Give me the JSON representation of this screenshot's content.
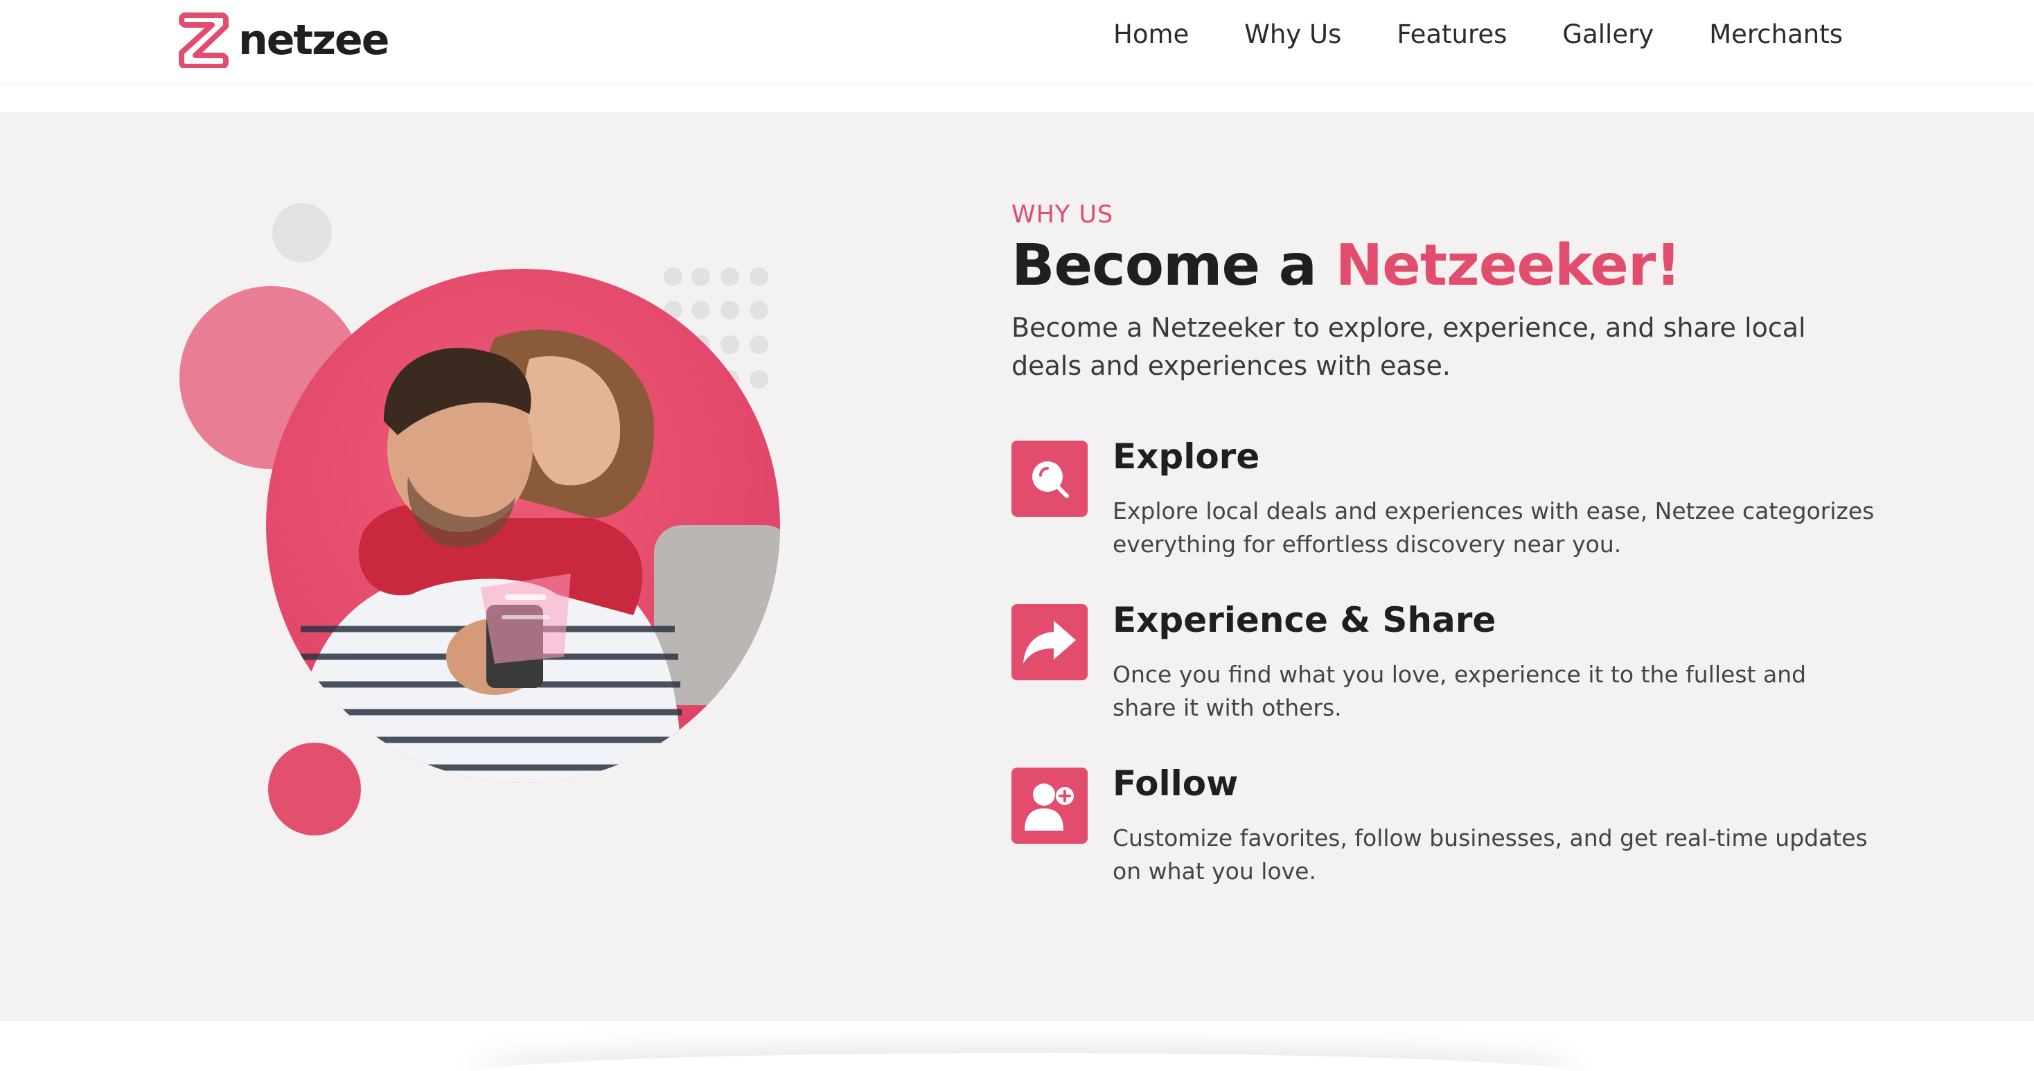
{
  "brand": {
    "name": "netzee",
    "accent": "#e34d6d"
  },
  "nav": {
    "items": [
      "Home",
      "Why Us",
      "Features",
      "Gallery",
      "Merchants"
    ]
  },
  "hero": {
    "eyebrow": "WHY US",
    "headline_prefix": "Become a ",
    "headline_accent": "Netzeeker!",
    "intro": "Become a Netzeeker to explore, experience, and share local deals and experiences with ease."
  },
  "features": [
    {
      "icon": "search-icon",
      "title": "Explore",
      "description": "Explore local deals and experiences with ease, Netzee categorizes everything for effortless discovery near you."
    },
    {
      "icon": "share-arrow-icon",
      "title": "Experience & Share",
      "description": "Once you find what you love, experience it to the fullest and share it with others."
    },
    {
      "icon": "user-plus-icon",
      "title": "Follow",
      "description": "Customize favorites, follow businesses, and get real-time updates on what you love."
    }
  ]
}
